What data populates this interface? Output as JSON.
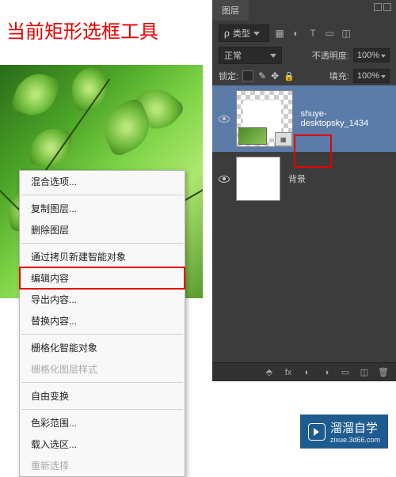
{
  "title": "当前矩形选框工具",
  "context_menu": [
    {
      "label": "混合选项...",
      "type": "item"
    },
    {
      "type": "sep"
    },
    {
      "label": "复制图层...",
      "type": "item"
    },
    {
      "label": "删除图层",
      "type": "item"
    },
    {
      "type": "sep"
    },
    {
      "label": "通过拷贝新建智能对象",
      "type": "item"
    },
    {
      "label": "编辑内容",
      "type": "item",
      "highlighted": true
    },
    {
      "label": "导出内容...",
      "type": "item"
    },
    {
      "label": "替换内容...",
      "type": "item"
    },
    {
      "type": "sep"
    },
    {
      "label": "栅格化智能对象",
      "type": "item"
    },
    {
      "label": "栅格化图层样式",
      "type": "item",
      "disabled": true
    },
    {
      "type": "sep"
    },
    {
      "label": "自由变换",
      "type": "item"
    },
    {
      "type": "sep"
    },
    {
      "label": "色彩范围...",
      "type": "item"
    },
    {
      "label": "载入选区...",
      "type": "item"
    },
    {
      "label": "重新选择",
      "type": "item",
      "disabled": true
    }
  ],
  "panel": {
    "tab": "图层",
    "kind_label": "类型",
    "blend_mode": "正常",
    "opacity_label": "不透明度:",
    "opacity_value": "100%",
    "lock_label": "锁定:",
    "fill_label": "填充:",
    "fill_value": "100%",
    "layer1_name": "shuye-desktopsky_1434",
    "layer2_name": "背景",
    "bottom_fx": "fx"
  },
  "watermark": {
    "main": "溜溜自学",
    "sub": "zixue.3d66.com"
  }
}
